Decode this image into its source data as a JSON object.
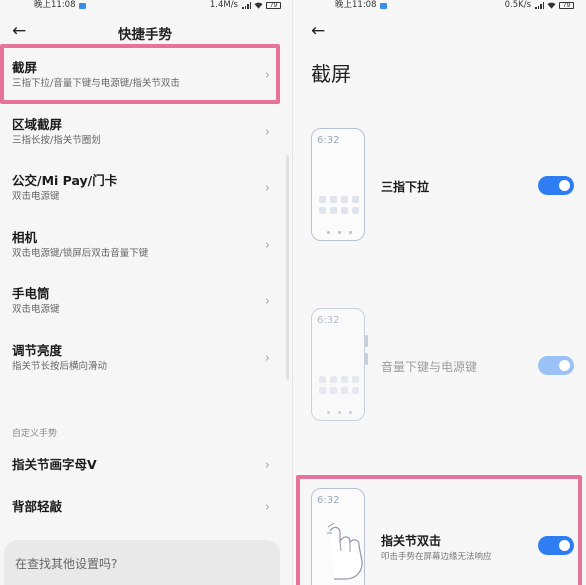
{
  "left_panel": {
    "status": {
      "time": "晚上11:08",
      "speed": "1.4M/s",
      "battery": "79"
    },
    "title": "快捷手势",
    "items": [
      {
        "title": "截屏",
        "subtitle": "三指下拉/音量下键与电源键/指关节双击"
      },
      {
        "title": "区域截屏",
        "subtitle": "三指长按/指关节圈划"
      },
      {
        "title": "公交/Mi Pay/门卡",
        "subtitle": "双击电源键"
      },
      {
        "title": "相机",
        "subtitle": "双击电源键/锁屏后双击音量下键"
      },
      {
        "title": "手电筒",
        "subtitle": "双击电源键"
      },
      {
        "title": "调节亮度",
        "subtitle": "指关节长按后横向滑动"
      }
    ],
    "section_label": "自定义手势",
    "custom_items": [
      {
        "title": "指关节画字母V"
      },
      {
        "title": "背部轻敲"
      }
    ],
    "search_placeholder": "在查找其他设置吗?",
    "highlight_color": "#e8739a"
  },
  "right_panel": {
    "status": {
      "time": "晚上11:08",
      "speed": "0.5K/s",
      "battery": "79"
    },
    "title": "截屏",
    "options": [
      {
        "label": "三指下拉",
        "clock": "6:32",
        "enabled": true,
        "available": true
      },
      {
        "label": "音量下键与电源键",
        "clock": "6:32",
        "enabled": true,
        "available": false
      },
      {
        "label": "指关节双击",
        "subtitle": "叩击手势在屏幕边缘无法响应",
        "clock": "6:32",
        "enabled": true,
        "available": true
      }
    ],
    "accent_color": "#2f7df2",
    "highlight_color": "#e8739a"
  },
  "icons": {
    "back": "back-arrow-icon",
    "chevron": "chevron-right-icon",
    "knuckle": "hand-knuckle-icon"
  }
}
